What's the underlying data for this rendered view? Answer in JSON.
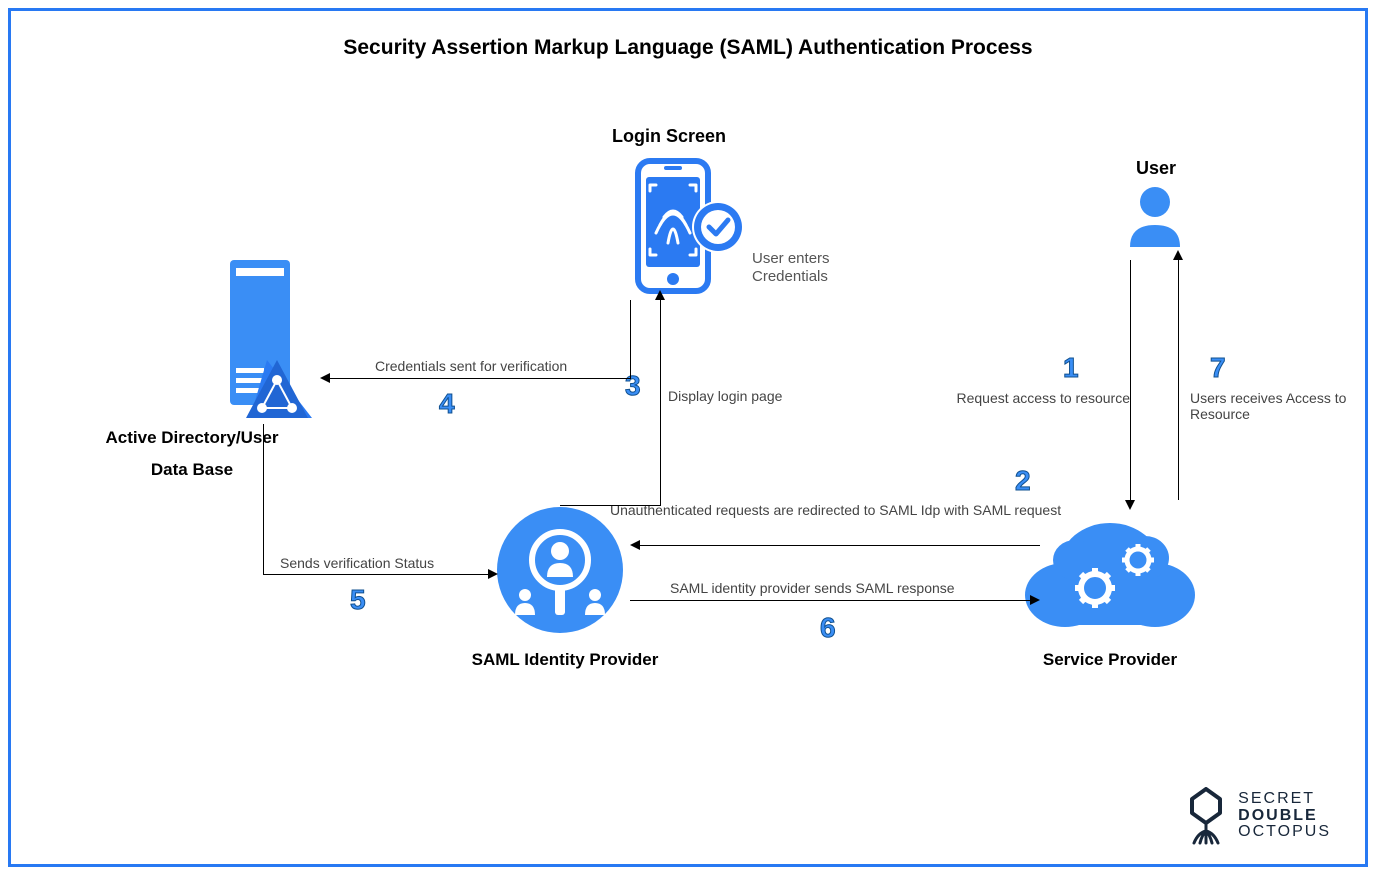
{
  "title": "Security Assertion Markup Language (SAML) Authentication Process",
  "nodes": {
    "loginScreen": {
      "label": "Login Screen",
      "sub": "User enters Credentials"
    },
    "user": {
      "label": "User"
    },
    "activeDirectory": {
      "label1": "Active Directory/User",
      "label2": "Data Base"
    },
    "idp": {
      "label": "SAML Identity Provider"
    },
    "sp": {
      "label": "Service Provider"
    }
  },
  "steps": {
    "s1": {
      "num": "1",
      "text": "Request access to resource"
    },
    "s2": {
      "num": "2",
      "text": "Unauthenticated requests are redirected to SAML Idp with SAML request"
    },
    "s3": {
      "num": "3",
      "text": "Display login page"
    },
    "s4": {
      "num": "4",
      "text": "Credentials sent for verification"
    },
    "s5": {
      "num": "5",
      "text": "Sends verification Status"
    },
    "s6": {
      "num": "6",
      "text": "SAML identity provider sends SAML response"
    },
    "s7": {
      "num": "7",
      "text": "Users receives Access to Resource"
    }
  },
  "logo": {
    "line1": "SECRET",
    "line2": "DOUBLE",
    "line3": "OCTOPUS"
  },
  "colors": {
    "blue": "#2879f3",
    "lightBlue": "#3a8ef5"
  }
}
